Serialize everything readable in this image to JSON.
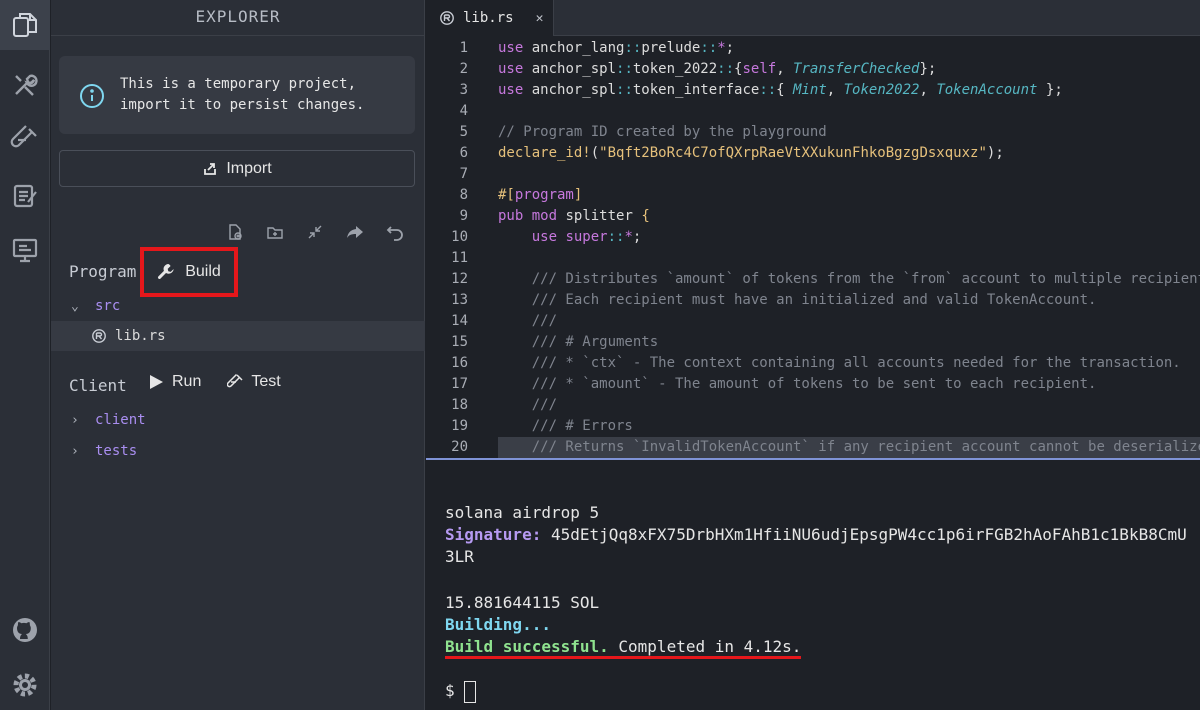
{
  "sidebar": {
    "title": "EXPLORER",
    "info": "This is a temporary project, import it to persist changes.",
    "import_label": "Import",
    "program_label": "Program",
    "build_label": "Build",
    "src_folder": "src",
    "file": "lib.rs",
    "client_label": "Client",
    "run_label": "Run",
    "test_label": "Test",
    "client_folder": "client",
    "tests_folder": "tests"
  },
  "tab": {
    "name": "lib.rs",
    "close": "✕"
  },
  "code_lines": [
    {
      "n": "1",
      "t": "use anchor_lang::prelude::*;"
    },
    {
      "n": "2",
      "t": "use anchor_spl::token_2022::{self, TransferChecked};"
    },
    {
      "n": "3",
      "t": "use anchor_spl::token_interface::{ Mint, Token2022, TokenAccount };"
    },
    {
      "n": "4",
      "t": ""
    },
    {
      "n": "5",
      "t": "// Program ID created by the playground"
    },
    {
      "n": "6",
      "t": "declare_id!(\"Bqft2BoRc4C7ofQXrpRaeVtXXukunFhkoBgzgDsxquxz\");"
    },
    {
      "n": "7",
      "t": ""
    },
    {
      "n": "8",
      "t": "#[program]"
    },
    {
      "n": "9",
      "t": "pub mod splitter {"
    },
    {
      "n": "10",
      "t": "    use super::*;"
    },
    {
      "n": "11",
      "t": ""
    },
    {
      "n": "12",
      "t": "    /// Distributes `amount` of tokens from the `from` account to multiple recipients"
    },
    {
      "n": "13",
      "t": "    /// Each recipient must have an initialized and valid TokenAccount."
    },
    {
      "n": "14",
      "t": "    ///"
    },
    {
      "n": "15",
      "t": "    /// # Arguments"
    },
    {
      "n": "16",
      "t": "    /// * `ctx` - The context containing all accounts needed for the transaction."
    },
    {
      "n": "17",
      "t": "    /// * `amount` - The amount of tokens to be sent to each recipient."
    },
    {
      "n": "18",
      "t": "    ///"
    },
    {
      "n": "19",
      "t": "    /// # Errors"
    },
    {
      "n": "20",
      "t": "    /// Returns `InvalidTokenAccount` if any recipient account cannot be deserialized"
    }
  ],
  "terminal": {
    "cmd": "solana airdrop 5",
    "sig_label": "Signature:",
    "sig_value": "45dEtjQq8xFX75DrbHXm1HfiiNU6udjEpsgPW4cc1p6irFGB2hAoFAhB1c1BkB8CmU",
    "sig_wrap": "3LR",
    "balance": "15.881644115 SOL",
    "building": "Building...",
    "success": "Build successful.",
    "completed": " Completed in 4.12s.",
    "prompt": "$ "
  },
  "colors": {
    "keyword": "#c678dd",
    "type": "#56b6c2",
    "string": "#e5c07b",
    "comment": "#7f848e",
    "highlight_box": "#e5171b"
  }
}
